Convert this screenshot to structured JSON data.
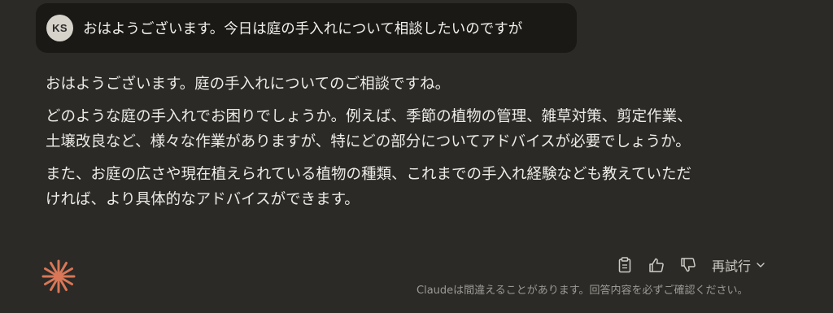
{
  "user_message": {
    "avatar_initials": "KS",
    "text": "おはようございます。今日は庭の手入れについて相談したいのですが"
  },
  "assistant_message": {
    "paragraphs": [
      [
        "おはようございます。庭の手入れについてのご相談ですね。"
      ],
      [
        "どのような庭の手入れでお困りでしょうか。例えば、季節の植物の管理、雑草対策、剪定作業、",
        "土壌改良など、様々な作業がありますが、特にどの部分についてアドバイスが必要でしょうか。"
      ],
      [
        "また、お庭の広さや現在植えられている植物の種類、これまでの手入れ経験なども教えていただ",
        "ければ、より具体的なアドバイスができます。"
      ]
    ]
  },
  "actions": {
    "copy_icon": "clipboard-icon",
    "thumbs_up_icon": "thumbs-up-icon",
    "thumbs_down_icon": "thumbs-down-icon",
    "retry_label": "再試行"
  },
  "footer": {
    "disclaimer": "Claudeは間違えることがあります。回答内容を必ずご確認ください。"
  },
  "colors": {
    "background": "#2b2a27",
    "user_bubble": "#1a1916",
    "claude_accent": "#d97757"
  }
}
